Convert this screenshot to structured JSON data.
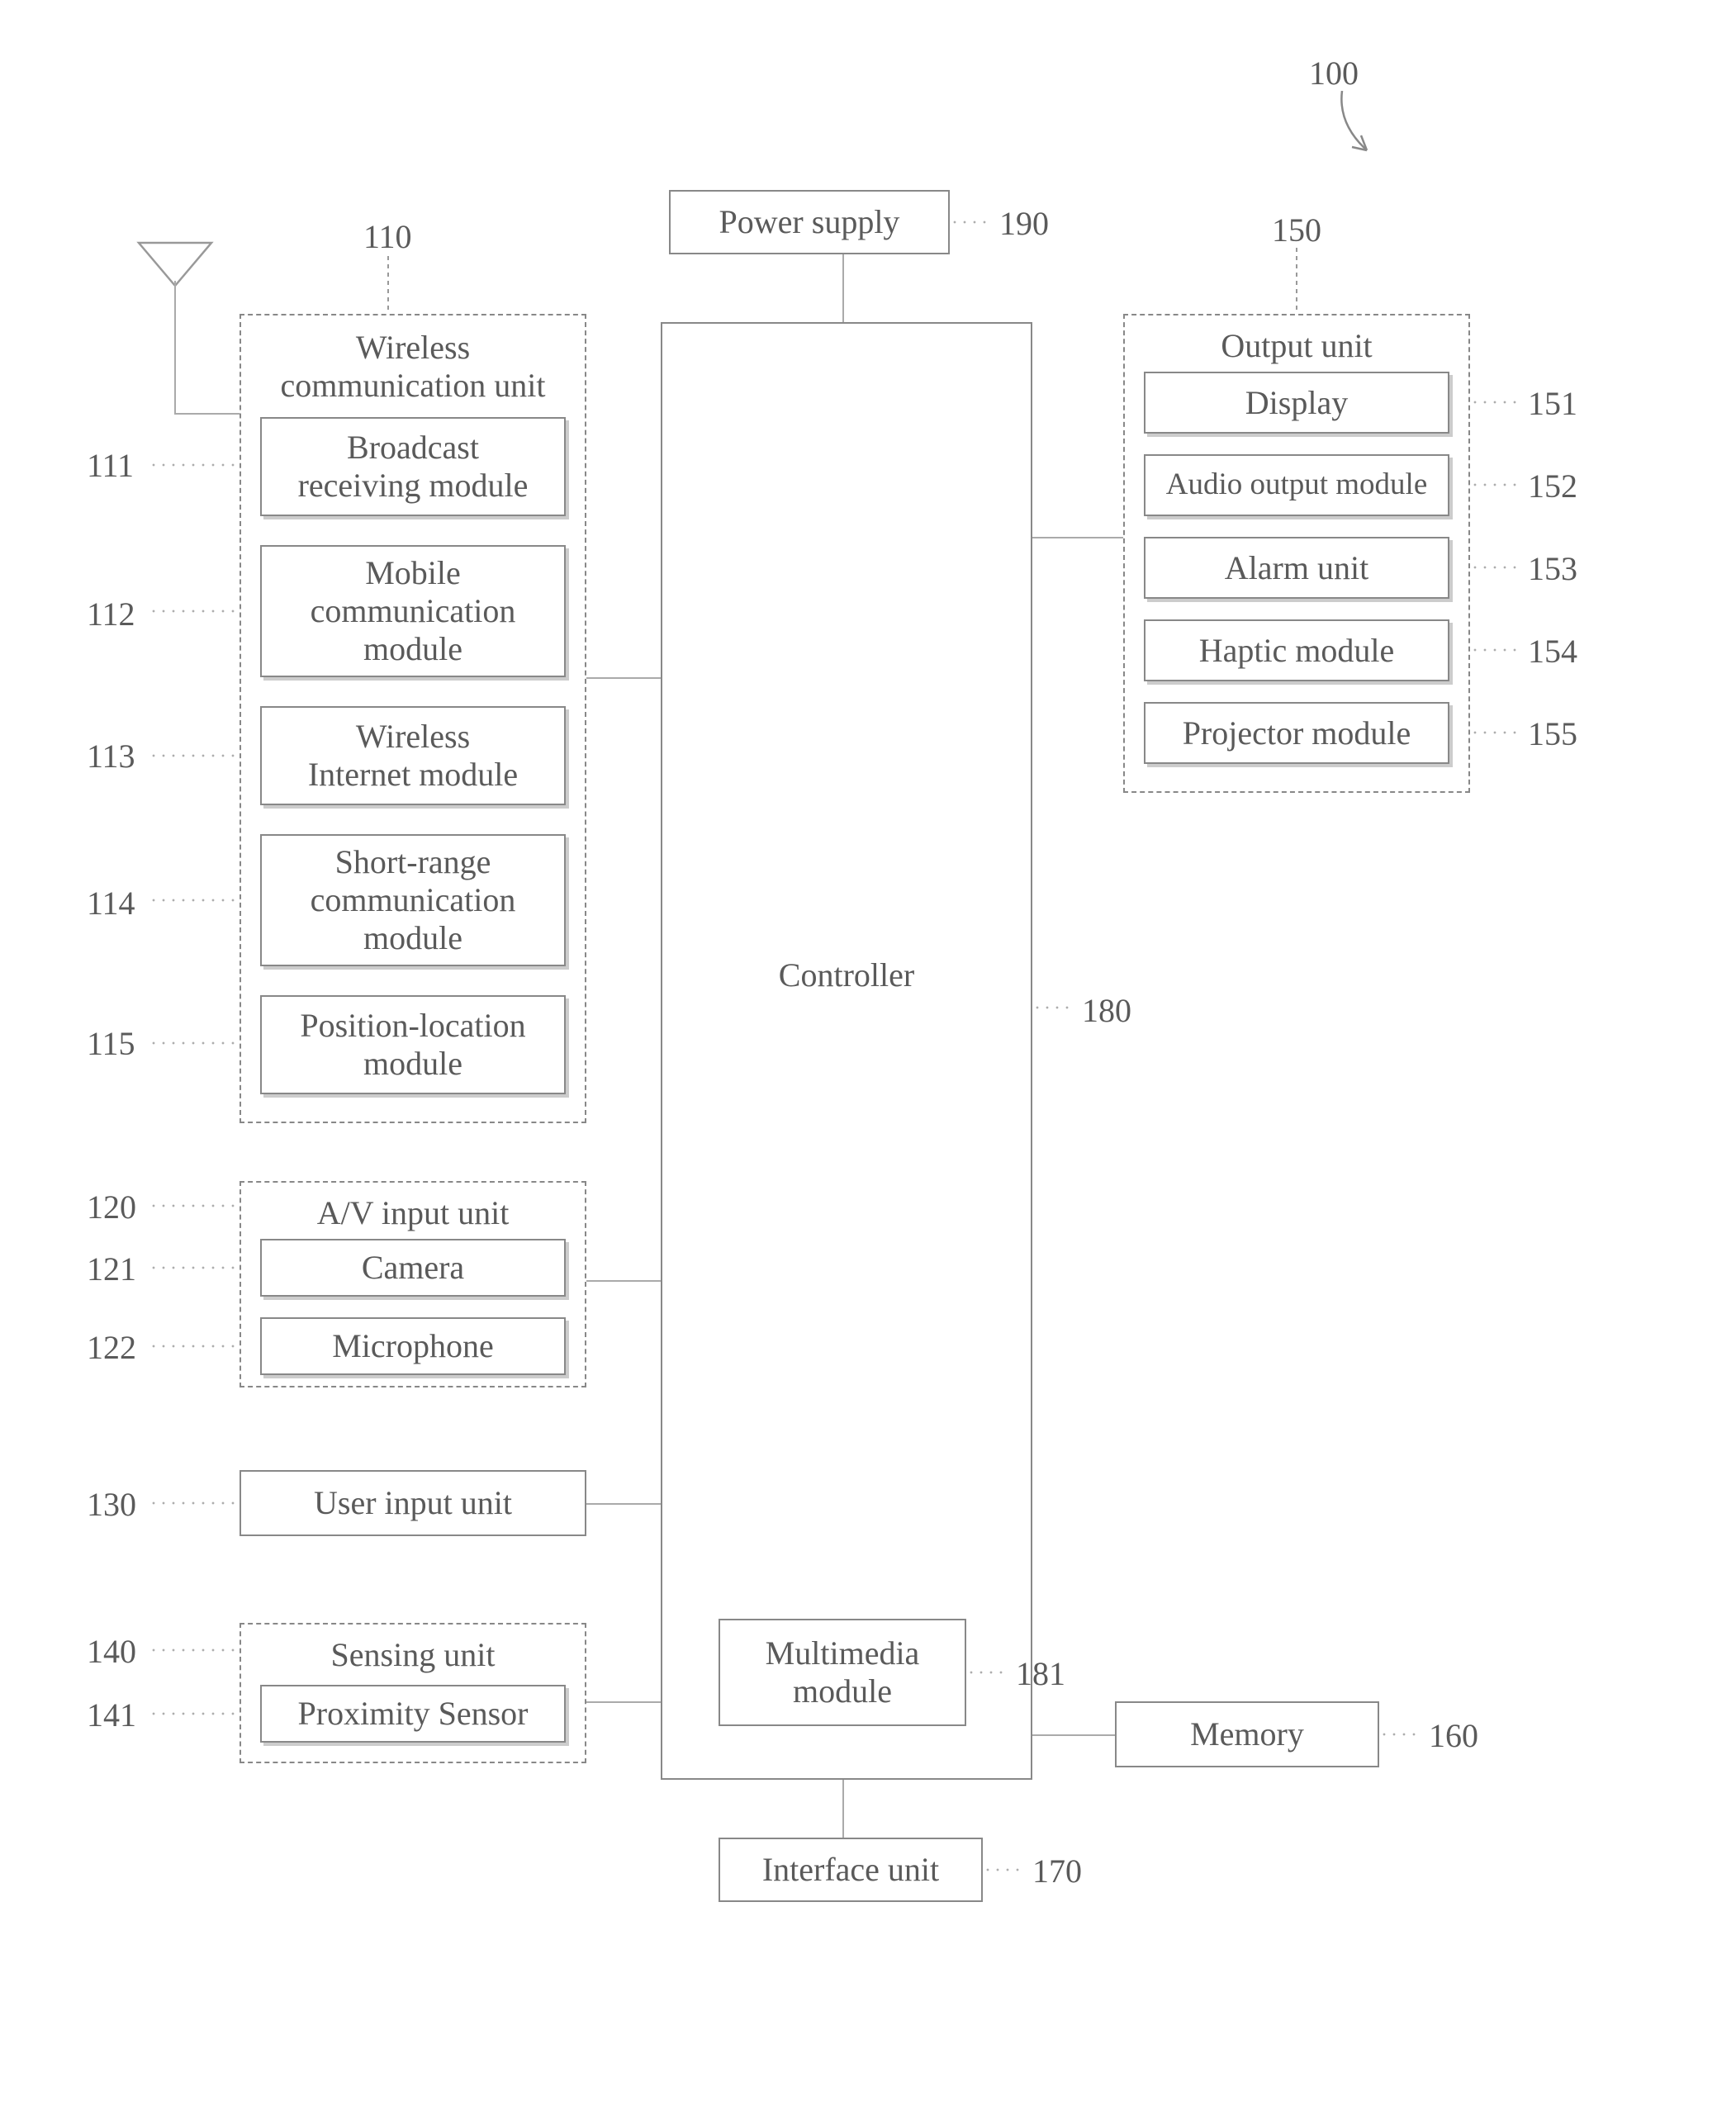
{
  "refs": {
    "r100": "100",
    "r110": "110",
    "r111": "111",
    "r112": "112",
    "r113": "113",
    "r114": "114",
    "r115": "115",
    "r120": "120",
    "r121": "121",
    "r122": "122",
    "r130": "130",
    "r140": "140",
    "r141": "141",
    "r150": "150",
    "r151": "151",
    "r152": "152",
    "r153": "153",
    "r154": "154",
    "r155": "155",
    "r160": "160",
    "r170": "170",
    "r180": "180",
    "r181": "181",
    "r190": "190"
  },
  "blocks": {
    "power_supply": "Power supply",
    "controller": "Controller",
    "multimedia_module": "Multimedia\nmodule",
    "memory": "Memory",
    "interface_unit": "Interface unit",
    "user_input_unit": "User input unit",
    "wireless_comm_unit_title": "Wireless\ncommunication unit",
    "broadcast_recv": "Broadcast\nreceiving module",
    "mobile_comm": "Mobile\ncommunication\nmodule",
    "wireless_internet": "Wireless\nInternet module",
    "short_range": "Short-range\ncommunication\nmodule",
    "position_location": "Position-location\nmodule",
    "av_input_title": "A/V input unit",
    "camera": "Camera",
    "microphone": "Microphone",
    "sensing_unit_title": "Sensing unit",
    "proximity_sensor": "Proximity Sensor",
    "output_unit_title": "Output unit",
    "display": "Display",
    "audio_output": "Audio output module",
    "alarm_unit": "Alarm  unit",
    "haptic_module": "Haptic module",
    "projector_module": "Projector module"
  }
}
